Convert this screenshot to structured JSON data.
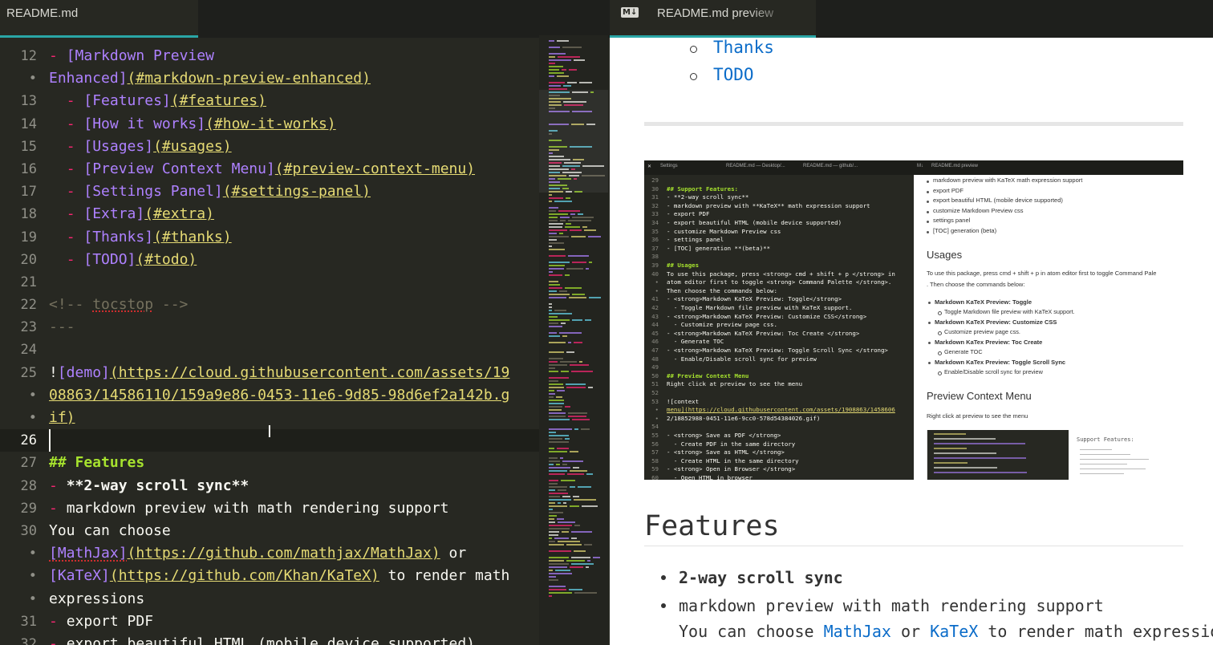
{
  "editor": {
    "tab_title": "README.md",
    "lines": [
      {
        "num": "12",
        "parts": [
          [
            "dash",
            "- "
          ],
          [
            "lt",
            "[Markdown Preview"
          ]
        ]
      },
      {
        "num": "•",
        "parts": [
          [
            "lt",
            "Enhanced]"
          ],
          [
            "url",
            "(#markdown-preview-enhanced)"
          ]
        ]
      },
      {
        "num": "13",
        "parts": [
          [
            "plain",
            "  "
          ],
          [
            "dash",
            "- "
          ],
          [
            "lt",
            "[Features]"
          ],
          [
            "url",
            "(#features)"
          ]
        ]
      },
      {
        "num": "14",
        "parts": [
          [
            "plain",
            "  "
          ],
          [
            "dash",
            "- "
          ],
          [
            "lt",
            "[How it works]"
          ],
          [
            "url",
            "(#how-it-works)"
          ]
        ]
      },
      {
        "num": "15",
        "parts": [
          [
            "plain",
            "  "
          ],
          [
            "dash",
            "- "
          ],
          [
            "lt",
            "[Usages]"
          ],
          [
            "url",
            "(#usages)"
          ]
        ]
      },
      {
        "num": "16",
        "parts": [
          [
            "plain",
            "  "
          ],
          [
            "dash",
            "- "
          ],
          [
            "lt",
            "[Preview Context Menu]"
          ],
          [
            "url",
            "(#preview-context-menu)"
          ]
        ]
      },
      {
        "num": "17",
        "parts": [
          [
            "plain",
            "  "
          ],
          [
            "dash",
            "- "
          ],
          [
            "lt",
            "[Settings Panel]"
          ],
          [
            "url",
            "(#settings-panel)"
          ]
        ]
      },
      {
        "num": "18",
        "parts": [
          [
            "plain",
            "  "
          ],
          [
            "dash",
            "- "
          ],
          [
            "lt",
            "[Extra]"
          ],
          [
            "url",
            "(#extra)"
          ]
        ]
      },
      {
        "num": "19",
        "parts": [
          [
            "plain",
            "  "
          ],
          [
            "dash",
            "- "
          ],
          [
            "lt",
            "[Thanks]"
          ],
          [
            "url",
            "(#thanks)"
          ]
        ]
      },
      {
        "num": "20",
        "parts": [
          [
            "plain",
            "  "
          ],
          [
            "dash",
            "- "
          ],
          [
            "lt",
            "[TODO]"
          ],
          [
            "url",
            "(#todo)"
          ]
        ]
      },
      {
        "num": "21",
        "parts": []
      },
      {
        "num": "22",
        "parts": [
          [
            "cmt",
            "<!-- "
          ],
          [
            "cmt spell",
            "tocstop"
          ],
          [
            "cmt",
            " -->"
          ]
        ]
      },
      {
        "num": "23",
        "parts": [
          [
            "cmt",
            "---"
          ]
        ]
      },
      {
        "num": "24",
        "parts": []
      },
      {
        "num": "25",
        "parts": [
          [
            "plain",
            "!"
          ],
          [
            "lt",
            "[demo]"
          ],
          [
            "url",
            "(https://cloud.githubusercontent.com/assets/19"
          ]
        ]
      },
      {
        "num": "•",
        "parts": [
          [
            "url",
            "08863/14586110/159a9e86-0453-11e6-9d85-98d6ef2a142b.g"
          ]
        ]
      },
      {
        "num": "•",
        "parts": [
          [
            "url",
            "if)"
          ]
        ]
      },
      {
        "num": "26",
        "parts": [],
        "current": true
      },
      {
        "num": "27",
        "parts": [
          [
            "hdr",
            "## Features"
          ]
        ]
      },
      {
        "num": "28",
        "parts": [
          [
            "dash",
            "- "
          ],
          [
            "bold",
            "**2-way scroll sync**"
          ]
        ]
      },
      {
        "num": "29",
        "parts": [
          [
            "dash",
            "- "
          ],
          [
            "plain",
            "markdown preview with math rendering support"
          ]
        ]
      },
      {
        "num": "30",
        "parts": [
          [
            "plain",
            "You can choose"
          ]
        ]
      },
      {
        "num": "•",
        "parts": [
          [
            "lt spell",
            "[MathJax]"
          ],
          [
            "url",
            "(https://github.com/mathjax/MathJax)"
          ],
          [
            "plain",
            " or"
          ]
        ]
      },
      {
        "num": "•",
        "parts": [
          [
            "lt",
            "[KaTeX]"
          ],
          [
            "url",
            "(https://github.com/Khan/KaTeX)"
          ],
          [
            "plain",
            " to render math"
          ]
        ]
      },
      {
        "num": "•",
        "parts": [
          [
            "plain",
            "expressions"
          ]
        ]
      },
      {
        "num": "31",
        "parts": [
          [
            "dash",
            "- "
          ],
          [
            "plain",
            "export PDF"
          ]
        ]
      },
      {
        "num": "32",
        "parts": [
          [
            "dash",
            "- "
          ],
          [
            "plain",
            "export beautiful HTML (mobile device supported)"
          ]
        ]
      }
    ]
  },
  "preview": {
    "tab_icon": "M↓",
    "tab_title": "README.md preview",
    "toc_items": [
      "Thanks",
      "TODO"
    ],
    "demo_image": {
      "tabs": [
        "Settings",
        "README.md — Desktop/...",
        "README.md — github/...",
        "README.md preview"
      ],
      "code_lines": [
        [
          "29",
          ""
        ],
        [
          "30",
          "## Support Features:"
        ],
        [
          "31",
          "- **2-way scroll sync**"
        ],
        [
          "32",
          "- markdown preview with **KaTeX** math expression support"
        ],
        [
          "33",
          "- export PDF"
        ],
        [
          "34",
          "- export beautiful HTML (mobile device supported)"
        ],
        [
          "35",
          "- customize Markdown Preview css"
        ],
        [
          "36",
          "- settings panel"
        ],
        [
          "37",
          "- [TOC] generation **(beta)**"
        ],
        [
          "38",
          ""
        ],
        [
          "39",
          "## Usages"
        ],
        [
          "40",
          "To use this package, press <strong> cmd + shift + p </strong> in"
        ],
        [
          "•",
          "atom editor first to toggle <strong> Command Palette </strong>."
        ],
        [
          "•",
          "Then choose the commands below:"
        ],
        [
          "41",
          "- <strong>Markdown KaTeX Preview: Toggle</strong>"
        ],
        [
          "42",
          "  - Toggle Markdown file preview with KaTeX support."
        ],
        [
          "43",
          "- <strong>Markdown KaTeX Preview: Customize CSS</strong>"
        ],
        [
          "44",
          "  - Customize preview page css."
        ],
        [
          "45",
          "- <strong>Markdown KaTeX Preview: Toc Create </strong>"
        ],
        [
          "46",
          "  - Generate TOC"
        ],
        [
          "47",
          "- <strong>Markdown KaTeX Preview: Toggle Scroll Sync </strong>"
        ],
        [
          "48",
          "  - Enable/Disable scroll sync for preview"
        ],
        [
          "49",
          ""
        ],
        [
          "50",
          "## Preview Context Menu"
        ],
        [
          "51",
          "Right click at preview to see the menu"
        ],
        [
          "52",
          ""
        ],
        [
          "53",
          "![context"
        ],
        [
          "•",
          "menu](https://cloud.githubusercontent.com/assets/1908863/1458606"
        ],
        [
          "•",
          "2/18852988-0451-11e6-9cc0-578d54384026.gif)"
        ],
        [
          "54",
          ""
        ],
        [
          "55",
          "- <strong> Save as PDF </strong>"
        ],
        [
          "56",
          "  - Create PDF in the same directory"
        ],
        [
          "57",
          "- <strong> Save as HTML </strong>"
        ],
        [
          "58",
          "  - Create HTML in the same directory"
        ],
        [
          "59",
          "- <strong> Open in Browser </strong>"
        ],
        [
          "60",
          "  - Open HTML in browser"
        ]
      ],
      "preview_bullets_top": [
        "markdown preview with KaTeX math expression support",
        "export PDF",
        "export beautiful HTML (mobile device supported)",
        "customize Markdown Preview css",
        "settings panel",
        "[TOC] generation (beta)"
      ],
      "usages_heading": "Usages",
      "usages_text": "To use this package, press cmd + shift + p in atom editor first to toggle Command Pale",
      "usages_text2": ". Then choose the commands below:",
      "commands": [
        [
          "Markdown KaTeX Preview: Toggle",
          "Toggle Markdown file preview with KaTeX support."
        ],
        [
          "Markdown KaTeX Preview: Customize CSS",
          "Customize preview page css."
        ],
        [
          "Markdown KaTex Preview: Toc Create",
          "Generate TOC"
        ],
        [
          "Markdown KaTex Preview: Toggle Scroll Sync",
          "Enable/Disable scroll sync for preview"
        ]
      ],
      "context_heading": "Preview Context Menu",
      "context_text": "Right click at preview to see the menu",
      "sub_heading": "Support Features:"
    },
    "features_heading": "Features",
    "features": {
      "item1": "2-way scroll sync",
      "item2": "markdown preview with math rendering support",
      "item2_sub_pre": "You can choose ",
      "item2_link1": "MathJax",
      "item2_mid": " or ",
      "item2_link2": "KaTeX",
      "item2_post": " to render math expressions"
    }
  },
  "colors": {
    "editor_bg": "#272822",
    "accent_tab": "#2aa6a6",
    "link_blue": "#0b6cc9",
    "markdown_bullet": "#f92672",
    "link_text": "#ae81ff",
    "url": "#e6db74",
    "heading": "#a6e22e"
  }
}
